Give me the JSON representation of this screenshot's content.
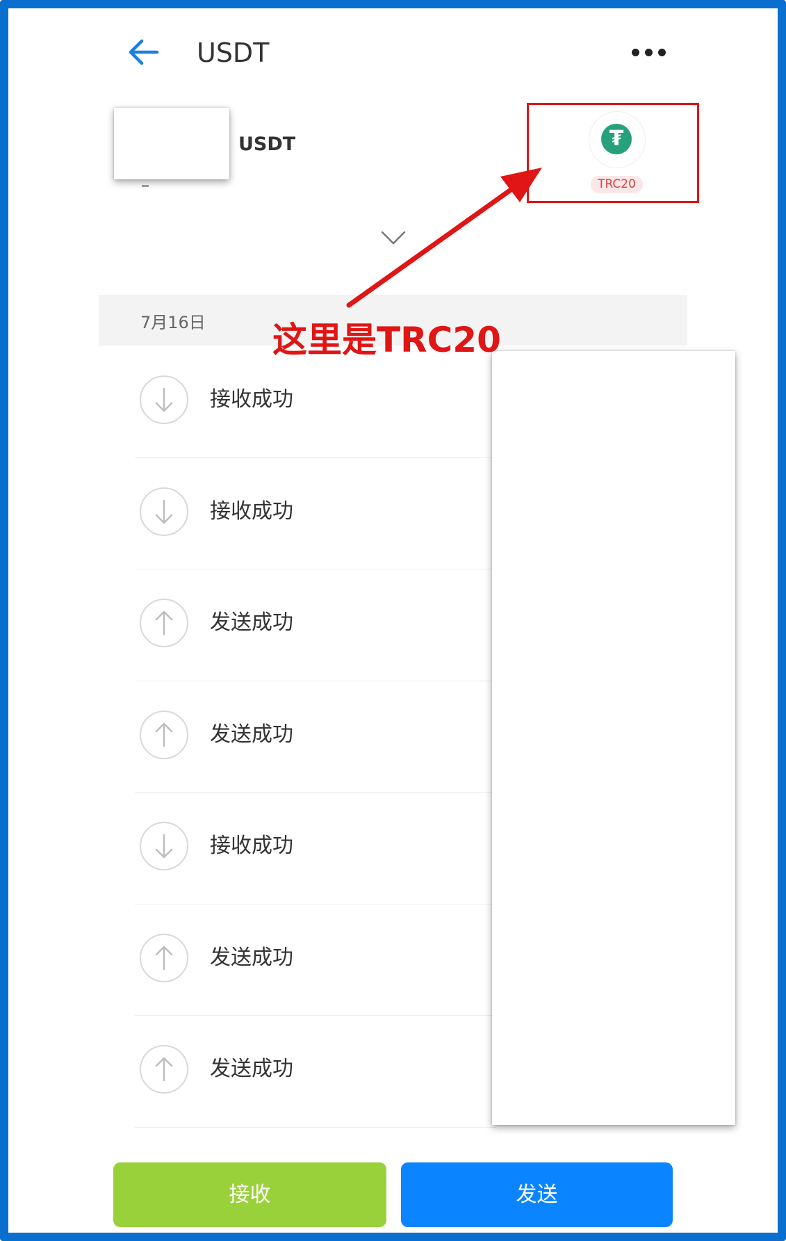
{
  "header": {
    "title": "USDT",
    "back_icon": "arrow-left-icon",
    "more_icon": "more-horizontal-icon"
  },
  "asset": {
    "name": "USDT",
    "sub_value": "-",
    "network_badge": "TRC20",
    "network_logo_glyph": "₮",
    "logo_color": "#26a17b"
  },
  "annotation": {
    "text": "这里是TRC20",
    "color": "#e01515"
  },
  "transactions": {
    "date": "7月16日",
    "items": [
      {
        "label": "接收成功",
        "direction": "in"
      },
      {
        "label": "接收成功",
        "direction": "in"
      },
      {
        "label": "发送成功",
        "direction": "out"
      },
      {
        "label": "发送成功",
        "direction": "out"
      },
      {
        "label": "接收成功",
        "direction": "in"
      },
      {
        "label": "发送成功",
        "direction": "out"
      },
      {
        "label": "发送成功",
        "direction": "out"
      }
    ]
  },
  "actions": {
    "receive_label": "接收",
    "send_label": "发送",
    "receive_color": "#99d13b",
    "send_color": "#0a84ff"
  }
}
